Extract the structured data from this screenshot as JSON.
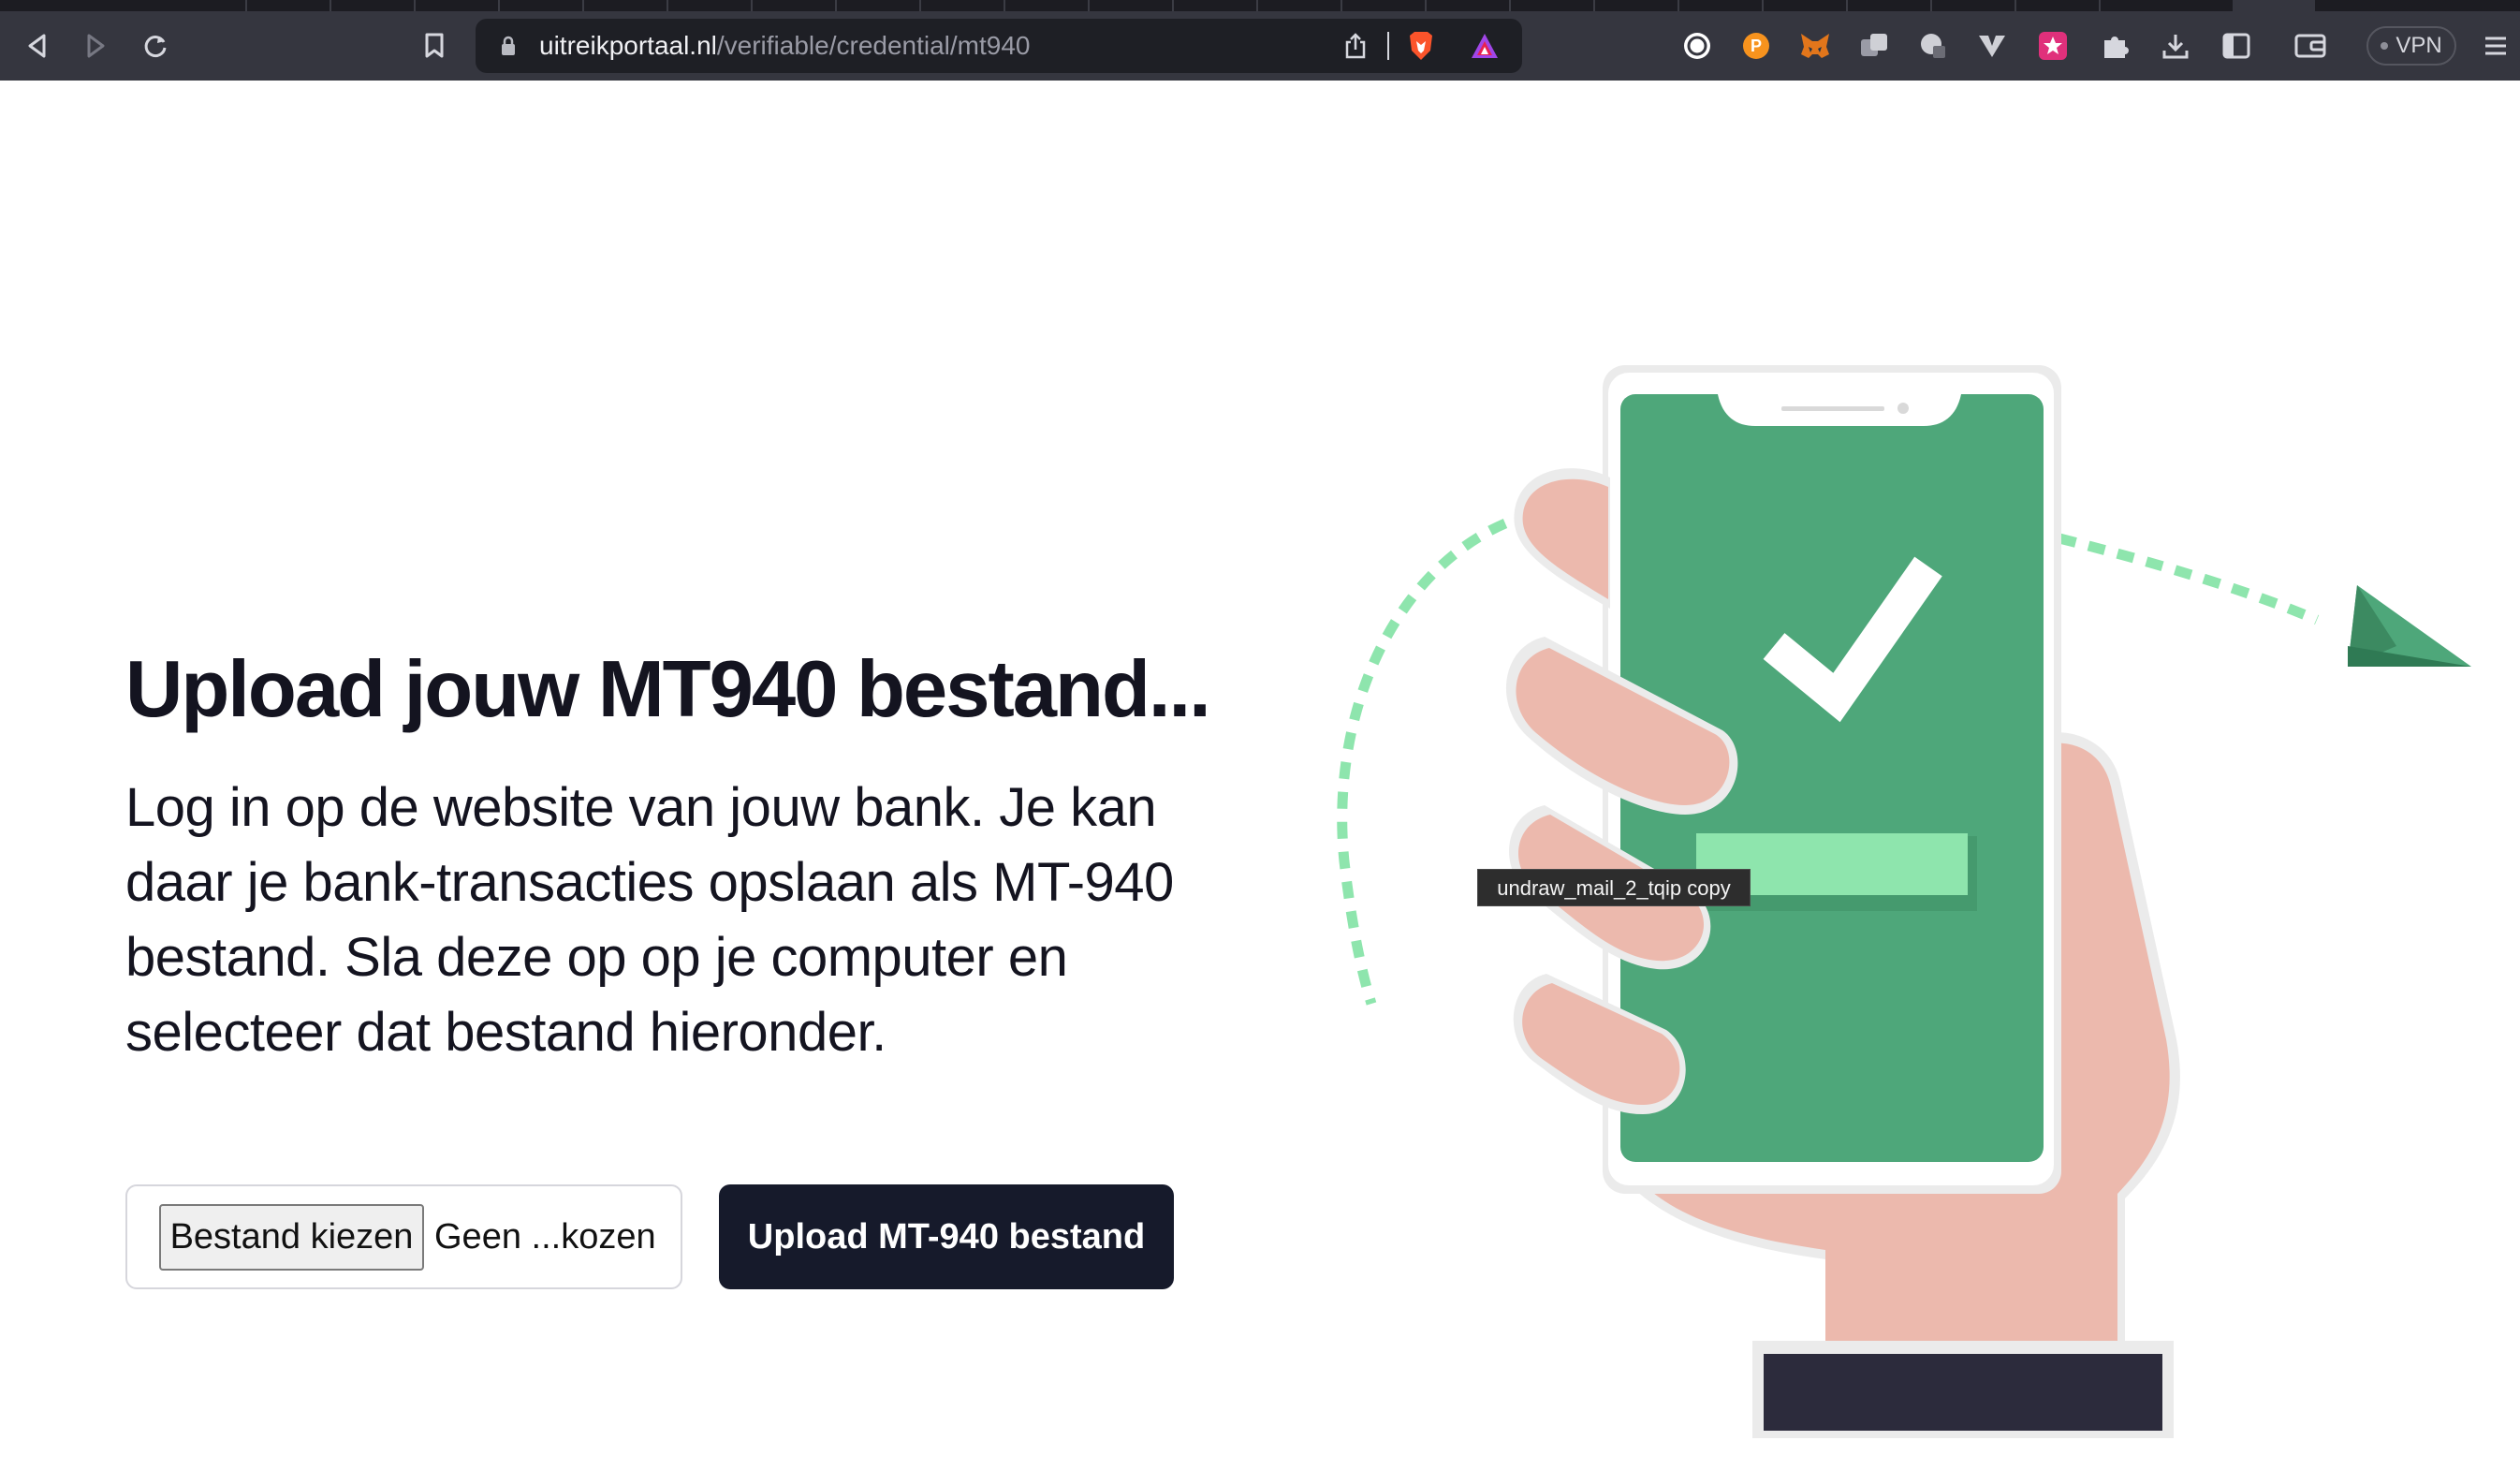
{
  "browser": {
    "url_host": "uitreikportaal.nl",
    "url_path": "/verifiable/credential/mt940",
    "vpn_label": "VPN",
    "icons": [
      "back-icon",
      "forward-icon",
      "reload-icon",
      "bookmark-icon",
      "lock-icon",
      "share-icon",
      "brave-shields-icon",
      "brave-rewards-icon",
      "extension-icon",
      "extension-icon",
      "metamask-icon",
      "extension-icon",
      "extension-icon",
      "extension-icon",
      "extension-icon",
      "extensions-puzzle-icon",
      "downloads-icon",
      "sidebar-icon",
      "wallet-icon",
      "menu-icon"
    ]
  },
  "page": {
    "headline": "Upload jouw MT940 bestand...",
    "lead": "Log in op de website van jouw bank. Je kan daar je bank-transacties opslaan als MT-940 bestand. Sla deze op op je computer en selecteer dat bestand hieronder.",
    "file_input": {
      "button_label": "Bestand kiezen",
      "status_text": "Geen ...kozen"
    },
    "upload_button_label": "Upload MT-940 bestand"
  },
  "illustration": {
    "tooltip": "undraw_mail_2_tqip copy",
    "colors": {
      "screen": "#4ea77a",
      "accent": "#8ee5ad",
      "skin": "#ecb9ad",
      "sleeve": "#2c2b3c"
    }
  }
}
